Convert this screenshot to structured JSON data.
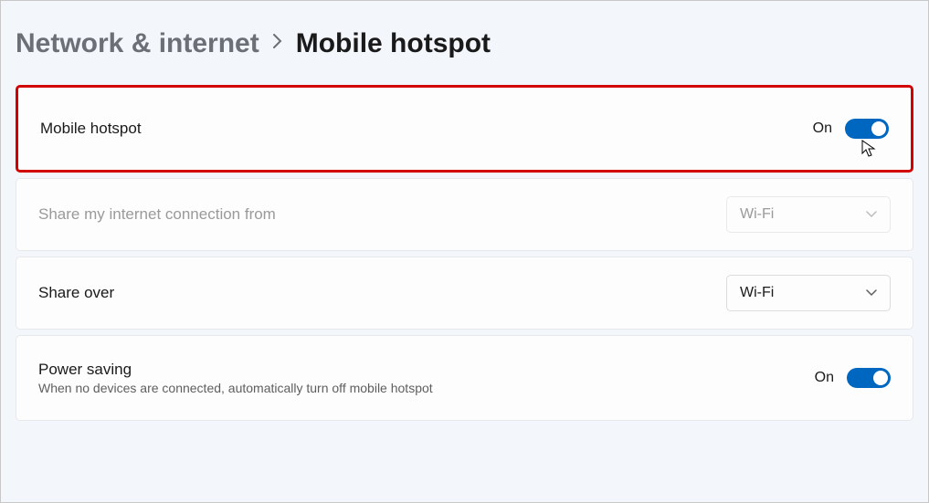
{
  "breadcrumb": {
    "parent": "Network & internet",
    "current": "Mobile hotspot"
  },
  "hotspot_card": {
    "label": "Mobile hotspot",
    "toggle_state": "On"
  },
  "share_from_card": {
    "label": "Share my internet connection from",
    "dropdown_value": "Wi-Fi"
  },
  "share_over_card": {
    "label": "Share over",
    "dropdown_value": "Wi-Fi"
  },
  "power_saving_card": {
    "label": "Power saving",
    "sublabel": "When no devices are connected, automatically turn off mobile hotspot",
    "toggle_state": "On"
  }
}
